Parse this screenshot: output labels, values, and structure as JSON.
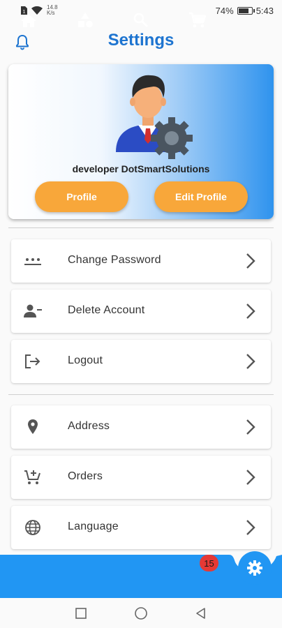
{
  "status_bar": {
    "speed_value": "14.8",
    "speed_unit": "K/s",
    "battery_text": "74%",
    "battery_level": 0.74,
    "time": "5:43"
  },
  "header": {
    "title": "Settings",
    "bell_icon": "bell-icon"
  },
  "profile_card": {
    "user_name": "developer DotSmartSolutions",
    "profile_button": "Profile",
    "edit_profile_button": "Edit Profile"
  },
  "account_menu": [
    {
      "label": "Change Password",
      "icon": "password-dots-icon"
    },
    {
      "label": "Delete Account",
      "icon": "person-remove-icon"
    },
    {
      "label": "Logout",
      "icon": "logout-icon"
    }
  ],
  "general_menu": [
    {
      "label": "Address",
      "icon": "location-pin-icon"
    },
    {
      "label": "Orders",
      "icon": "cart-add-icon"
    },
    {
      "label": "Language",
      "icon": "globe-icon"
    }
  ],
  "bottom_nav": {
    "items": [
      "home-icon",
      "categories-icon",
      "search-icon",
      "cart-icon"
    ],
    "cart_badge": "15",
    "active": "settings"
  },
  "colors": {
    "primary": "#2196f3",
    "title": "#1d74d0",
    "button": "#f8a73a",
    "badge": "#e53935"
  }
}
